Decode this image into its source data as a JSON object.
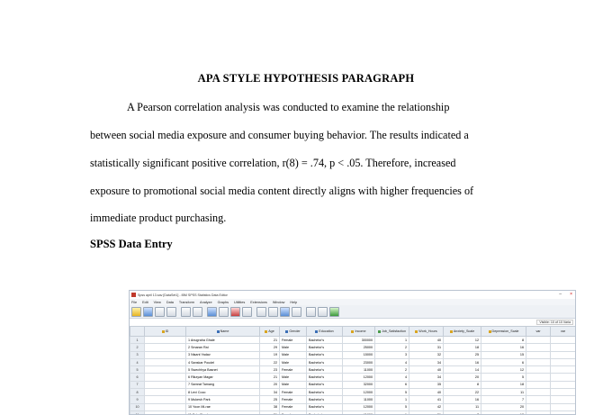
{
  "document": {
    "title": "APA STYLE HYPOTHESIS PARAGRAPH",
    "paragraph_lines": [
      "A Pearson correlation analysis was conducted to examine the relationship",
      "between social media exposure and consumer buying behavior. The results indicated a",
      "statistically significant positive correlation, r(8) = .74, p < .05. Therefore, increased",
      "exposure to promotional social media content directly aligns with higher frequencies of",
      "immediate product purchasing."
    ],
    "section_heading": "SPSS Data Entry"
  },
  "spss": {
    "window_title": "Spss april 13.sav [DataSet1] - IBM SPSS Statistics Data Editor",
    "menu": [
      "File",
      "Edit",
      "View",
      "Data",
      "Transform",
      "Analyze",
      "Graphs",
      "Utilities",
      "Extensions",
      "Window",
      "Help"
    ],
    "visible_label": "Visible: 10 of 10 Varia",
    "columns": [
      "ID",
      "Name",
      "Age",
      "Gender",
      "Education",
      "Income",
      "Job_Satisfaction",
      "Work_Hours",
      "Anxiety_Scale",
      "Depression_Scale",
      "var",
      "var"
    ],
    "rows": [
      {
        "rn": "1",
        "id": "",
        "name": "1 Anugraha Ghale",
        "age": "21",
        "gender": "Female",
        "edu": "Bachelor's",
        "income": "300000",
        "job": "1",
        "hours": "40",
        "anx": "12",
        "dep": "8"
      },
      {
        "rn": "2",
        "id": "",
        "name": "2 Smaran Rai",
        "age": "29",
        "gender": "Male",
        "edu": "Bachelor's",
        "income": "25000",
        "job": "2",
        "hours": "31",
        "anx": "18",
        "dep": "16"
      },
      {
        "rn": "3",
        "id": "",
        "name": "3 Nisant Yadav",
        "age": "19",
        "gender": "Male",
        "edu": "Bachelor's",
        "income": "15000",
        "job": "3",
        "hours": "32",
        "anx": "25",
        "dep": "15"
      },
      {
        "rn": "4",
        "id": "",
        "name": "4 Sanskar Poudel",
        "age": "22",
        "gender": "Male",
        "edu": "Bachelor's",
        "income": "23000",
        "job": "4",
        "hours": "34",
        "anx": "16",
        "dep": "6"
      },
      {
        "rn": "5",
        "id": "",
        "name": "5 Swechhya Basnet",
        "age": "23",
        "gender": "Female",
        "edu": "Bachelor's",
        "income": "11000",
        "job": "2",
        "hours": "40",
        "anx": "14",
        "dep": "12"
      },
      {
        "rn": "6",
        "id": "",
        "name": "6 Rikzyan Magar",
        "age": "21",
        "gender": "Male",
        "edu": "Bachelor's",
        "income": "12000",
        "job": "4",
        "hours": "34",
        "anx": "20",
        "dep": "5"
      },
      {
        "rn": "7",
        "id": "",
        "name": "7 Samrat Tamang",
        "age": "20",
        "gender": "Male",
        "edu": "Bachelor's",
        "income": "32000",
        "job": "6",
        "hours": "35",
        "anx": "8",
        "dep": "18"
      },
      {
        "rn": "8",
        "id": "",
        "name": "8 Levi Coco",
        "age": "34",
        "gender": "Female",
        "edu": "Bachelor's",
        "income": "12000",
        "job": "5",
        "hours": "40",
        "anx": "22",
        "dep": "11"
      },
      {
        "rn": "9",
        "id": "",
        "name": "9 Mukesh Park",
        "age": "25",
        "gender": "Female",
        "edu": "Bachelor's",
        "income": "11000",
        "job": "1",
        "hours": "41",
        "anx": "16",
        "dep": "7"
      },
      {
        "rn": "10",
        "id": "",
        "name": "10 Yoon Mi-rae",
        "age": "38",
        "gender": "Female",
        "edu": "Bachelor's",
        "income": "12000",
        "job": "5",
        "hours": "42",
        "anx": "11",
        "dep": "20"
      },
      {
        "rn": "11",
        "id": "",
        "name": "11 Sala Rumba",
        "age": "21",
        "gender": "Female",
        "edu": "Bachelor's",
        "income": "11000",
        "job": "1",
        "hours": "31",
        "anx": "7",
        "dep": "13"
      }
    ]
  }
}
